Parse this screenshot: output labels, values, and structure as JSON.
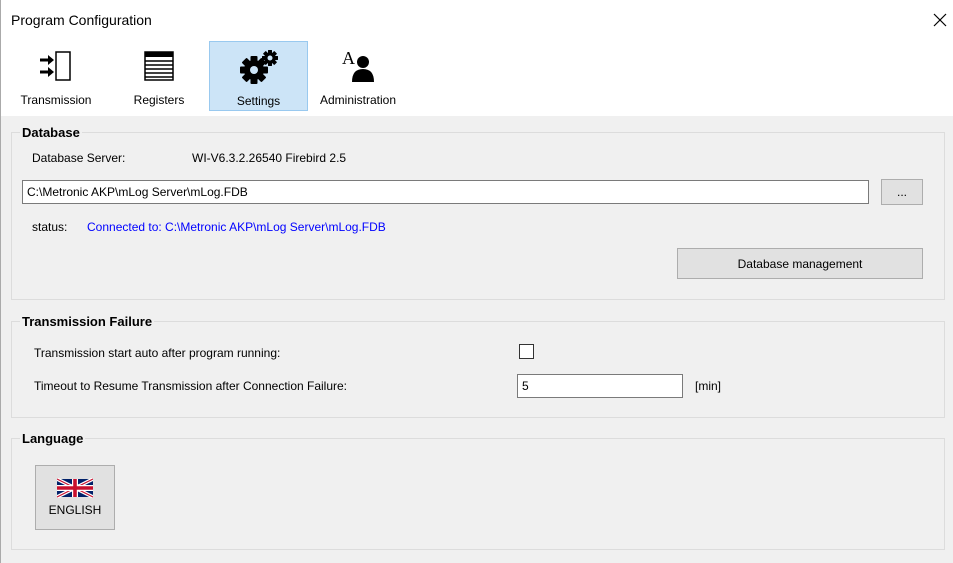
{
  "window": {
    "title": "Program Configuration"
  },
  "toolbar": {
    "items": [
      {
        "label": "Transmission",
        "icon": "transmission-icon"
      },
      {
        "label": "Registers",
        "icon": "registers-icon"
      },
      {
        "label": "Settings",
        "icon": "gears-icon",
        "active": true
      },
      {
        "label": "Administration",
        "icon": "admin-user-icon"
      }
    ]
  },
  "database": {
    "title": "Database",
    "server_label": "Database Server:",
    "server_value": "WI-V6.3.2.26540 Firebird 2.5",
    "path": "C:\\Metronic AKP\\mLog Server\\mLog.FDB",
    "browse_label": "...",
    "status_label": "status:",
    "status_value": "Connected to: C:\\Metronic AKP\\mLog Server\\mLog.FDB",
    "status_color": "#0000ff",
    "management_button": "Database management"
  },
  "transmission_failure": {
    "title": "Transmission Failure",
    "auto_start_label": "Transmission start auto after program running:",
    "auto_start_checked": false,
    "timeout_label": "Timeout to Resume Transmission after Connection Failure:",
    "timeout_value": "5",
    "timeout_unit": "[min]"
  },
  "language": {
    "title": "Language",
    "english_label": "ENGLISH"
  },
  "colors": {
    "active_tab_bg": "#cce4f7",
    "active_tab_border": "#99c9ef",
    "panel_bg": "#f0f0f0"
  }
}
